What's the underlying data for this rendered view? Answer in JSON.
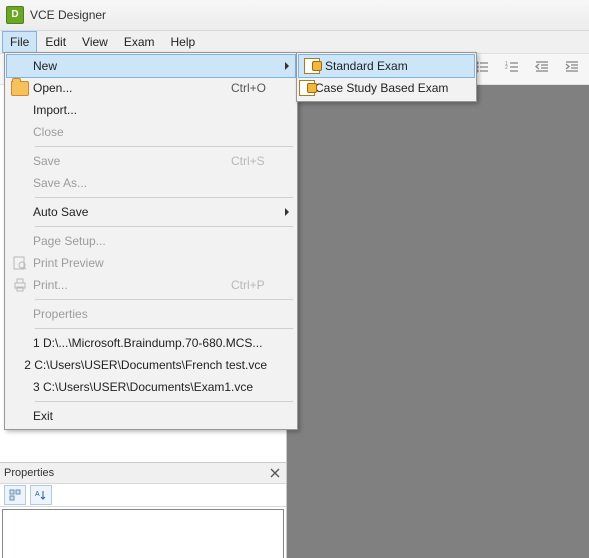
{
  "titlebar": {
    "title": "VCE Designer"
  },
  "menubar": {
    "items": [
      "File",
      "Edit",
      "View",
      "Exam",
      "Help"
    ]
  },
  "file_menu": {
    "new": {
      "label": "New"
    },
    "open": {
      "label": "Open...",
      "shortcut": "Ctrl+O"
    },
    "import": {
      "label": "Import..."
    },
    "close": {
      "label": "Close"
    },
    "save": {
      "label": "Save",
      "shortcut": "Ctrl+S"
    },
    "save_as": {
      "label": "Save As..."
    },
    "auto_save": {
      "label": "Auto Save"
    },
    "page_setup": {
      "label": "Page Setup..."
    },
    "print_prev": {
      "label": "Print Preview"
    },
    "print": {
      "label": "Print...",
      "shortcut": "Ctrl+P"
    },
    "properties": {
      "label": "Properties"
    },
    "recent": [
      "1 D:\\...\\Microsoft.Braindump.70-680.MCS...",
      "2 C:\\Users\\USER\\Documents\\French test.vce",
      "3 C:\\Users\\USER\\Documents\\Exam1.vce"
    ],
    "exit": {
      "label": "Exit"
    }
  },
  "new_submenu": {
    "standard": {
      "label": "Standard Exam"
    },
    "case_study": {
      "label": "Case Study Based Exam"
    }
  },
  "properties_panel": {
    "title": "Properties"
  }
}
